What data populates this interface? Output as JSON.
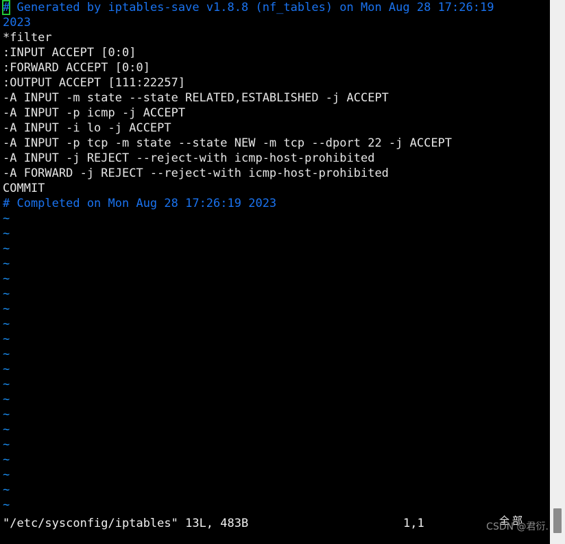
{
  "editor": {
    "lines": [
      {
        "text": "# Generated by iptables-save v1.8.8 (nf_tables) on Mon Aug 28 17:26:19",
        "kind": "comment",
        "cursor": true
      },
      {
        "text": "2023",
        "kind": "comment",
        "cursor": false
      },
      {
        "text": "*filter",
        "kind": "text",
        "cursor": false
      },
      {
        "text": ":INPUT ACCEPT [0:0]",
        "kind": "text",
        "cursor": false
      },
      {
        "text": ":FORWARD ACCEPT [0:0]",
        "kind": "text",
        "cursor": false
      },
      {
        "text": ":OUTPUT ACCEPT [111:22257]",
        "kind": "text",
        "cursor": false
      },
      {
        "text": "-A INPUT -m state --state RELATED,ESTABLISHED -j ACCEPT",
        "kind": "text",
        "cursor": false
      },
      {
        "text": "-A INPUT -p icmp -j ACCEPT",
        "kind": "text",
        "cursor": false
      },
      {
        "text": "-A INPUT -i lo -j ACCEPT",
        "kind": "text",
        "cursor": false
      },
      {
        "text": "-A INPUT -p tcp -m state --state NEW -m tcp --dport 22 -j ACCEPT",
        "kind": "text",
        "cursor": false
      },
      {
        "text": "-A INPUT -j REJECT --reject-with icmp-host-prohibited",
        "kind": "text",
        "cursor": false
      },
      {
        "text": "-A FORWARD -j REJECT --reject-with icmp-host-prohibited",
        "kind": "text",
        "cursor": false
      },
      {
        "text": "COMMIT",
        "kind": "text",
        "cursor": false
      },
      {
        "text": "# Completed on Mon Aug 28 17:26:19 2023",
        "kind": "comment",
        "cursor": false
      }
    ],
    "filler_symbol": "~",
    "filler_count": 20
  },
  "statusline": {
    "file_info": "\"/etc/sysconfig/iptables\" 13L, 483B",
    "position": "1,1",
    "scroll_indicator": "全部"
  },
  "watermark": {
    "text": "CSDN @君衍."
  },
  "colors": {
    "background": "#000000",
    "foreground": "#e6e6e6",
    "comment": "#1a73f0",
    "tilde": "#1a8cf0",
    "cursor_outline": "#22c93a",
    "scrollbar_track": "#efefef",
    "scrollbar_thumb": "#8b8b8b",
    "watermark": "#8e8e8e"
  }
}
